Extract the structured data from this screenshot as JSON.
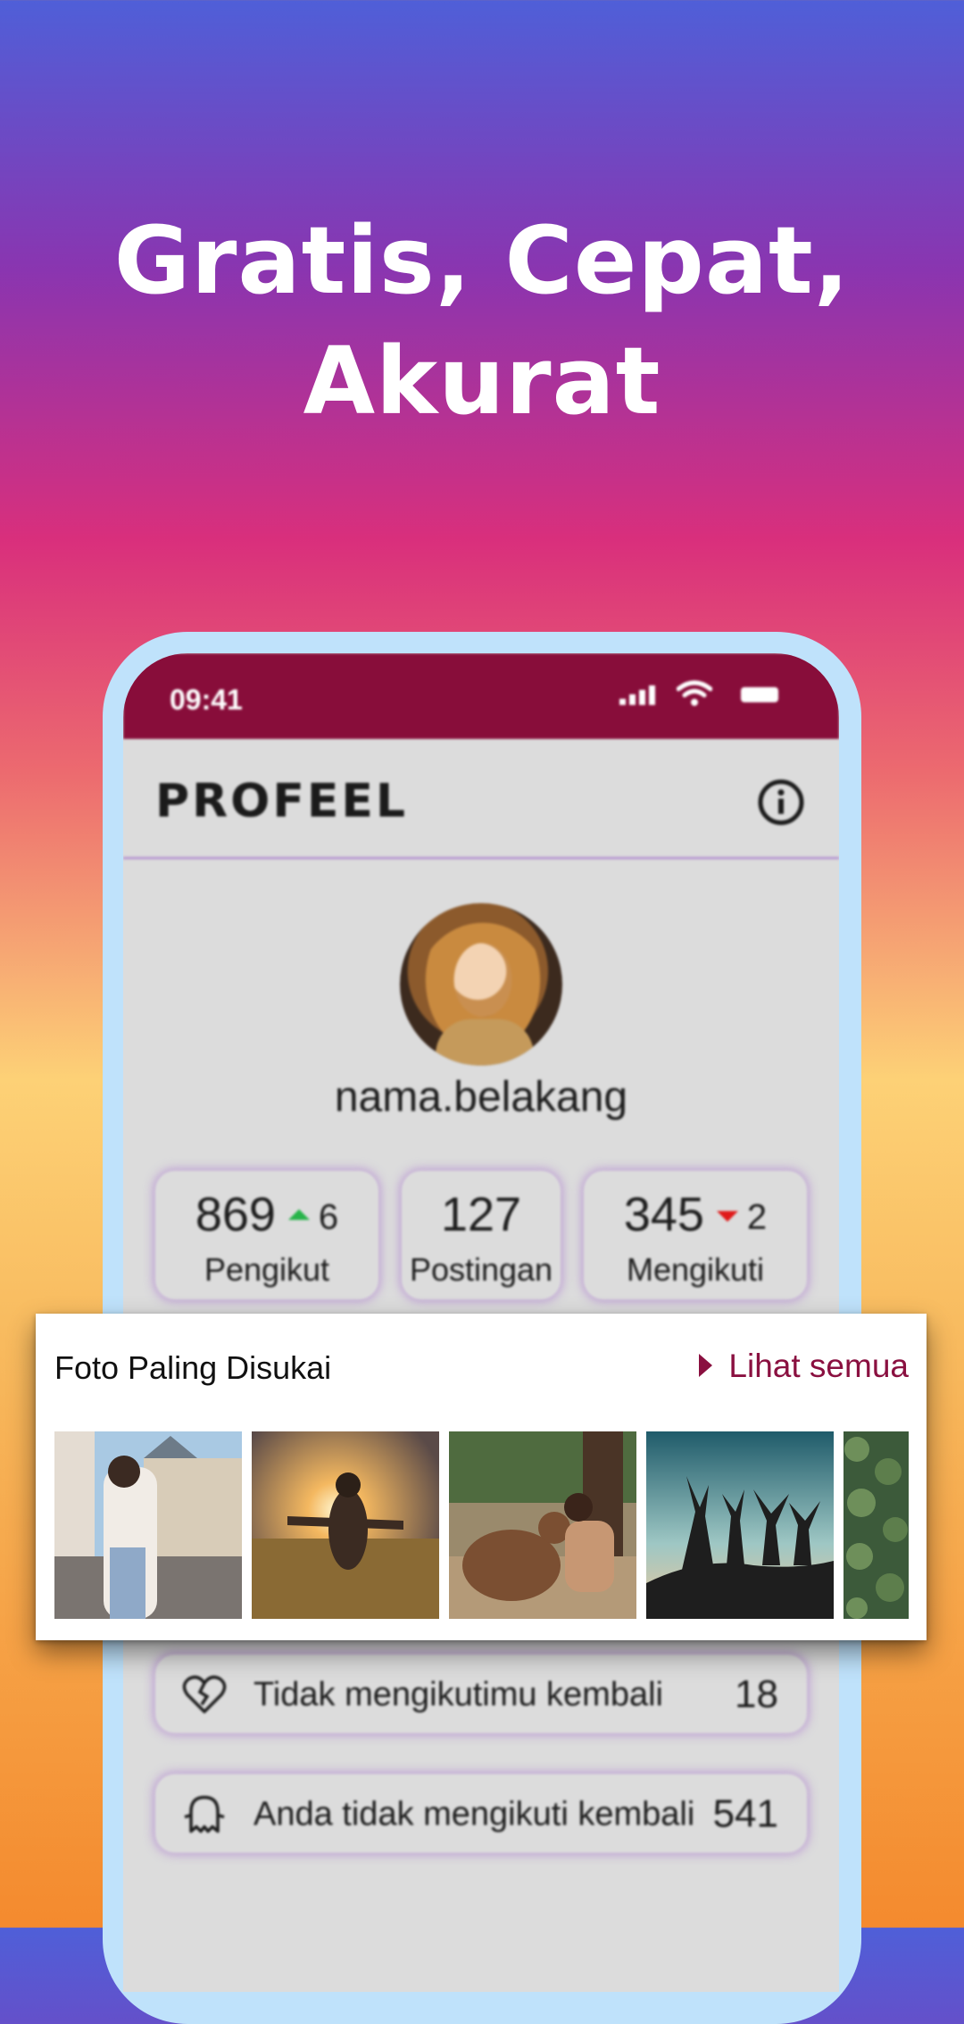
{
  "headline": [
    "Gratis, Cepat,",
    "Akurat"
  ],
  "status_bar": {
    "time": "09:41"
  },
  "app": {
    "brand": "PROFEEL"
  },
  "profile": {
    "username": "nama.belakang"
  },
  "stats": {
    "followers": {
      "value": "869",
      "delta": "6",
      "trend": "up",
      "label": "Pengikut"
    },
    "posts": {
      "value": "127",
      "label": "Postingan"
    },
    "following": {
      "value": "345",
      "delta": "2",
      "trend": "down",
      "label": "Mengikuti"
    }
  },
  "top_photos": {
    "title": "Foto Paling Disukai",
    "see_all": "Lihat semua"
  },
  "lists": [
    {
      "label": "Tidak mengikutimu kembali",
      "count": "18",
      "icon": "broken-heart-icon"
    },
    {
      "label": "Anda tidak mengikuti kembali",
      "count": "541",
      "icon": "ghost-icon"
    }
  ],
  "colors": {
    "accent": "#880d3a",
    "link": "#8a1040",
    "up": "#27b44a",
    "down": "#e01a1a"
  }
}
